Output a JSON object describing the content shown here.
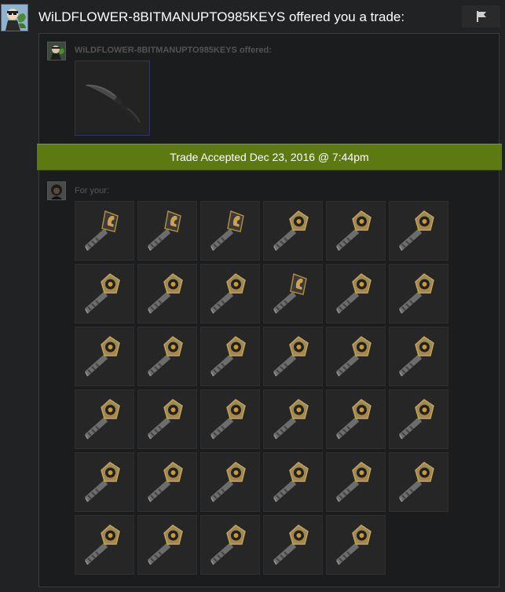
{
  "header": {
    "title": "WiLDFLOWER-8BITMANUPTO985KEYS offered you a trade:",
    "report_icon": "flag-icon"
  },
  "offer": {
    "offered_label": "WiLDFLOWER-8BITMANUPTO985KEYS offered:",
    "offered_item": {
      "name": "knife",
      "icon": "knife-icon"
    },
    "status": "Trade Accepted Dec 23, 2016 @ 7:44pm",
    "status_color": "#5d7a12",
    "for_label": "For your:"
  },
  "keys": [
    {
      "type": "falchion"
    },
    {
      "type": "falchion"
    },
    {
      "type": "falchion"
    },
    {
      "type": "chroma"
    },
    {
      "type": "chroma"
    },
    {
      "type": "chroma"
    },
    {
      "type": "chroma"
    },
    {
      "type": "chroma"
    },
    {
      "type": "chroma"
    },
    {
      "type": "falchion"
    },
    {
      "type": "chroma"
    },
    {
      "type": "chroma"
    },
    {
      "type": "chroma"
    },
    {
      "type": "chroma"
    },
    {
      "type": "chroma"
    },
    {
      "type": "chroma"
    },
    {
      "type": "chroma"
    },
    {
      "type": "chroma"
    },
    {
      "type": "chroma"
    },
    {
      "type": "chroma"
    },
    {
      "type": "chroma"
    },
    {
      "type": "chroma"
    },
    {
      "type": "chroma"
    },
    {
      "type": "chroma"
    },
    {
      "type": "chroma"
    },
    {
      "type": "chroma"
    },
    {
      "type": "chroma"
    },
    {
      "type": "chroma"
    },
    {
      "type": "chroma"
    },
    {
      "type": "chroma"
    },
    {
      "type": "chroma"
    },
    {
      "type": "chroma"
    },
    {
      "type": "chroma"
    },
    {
      "type": "chroma"
    },
    {
      "type": "chroma"
    }
  ]
}
